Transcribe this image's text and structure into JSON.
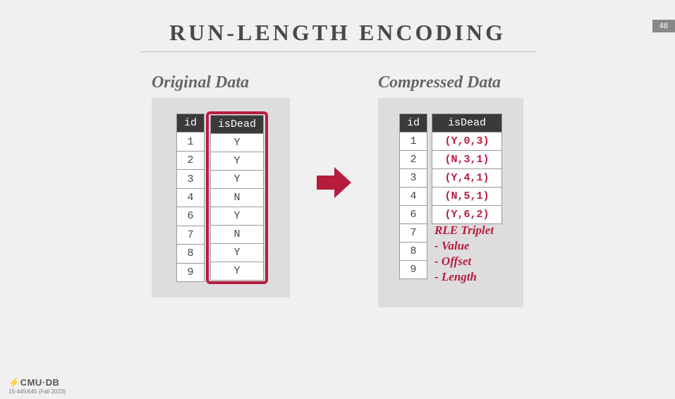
{
  "slideNumber": "48",
  "title": "RUN-LENGTH ENCODING",
  "original": {
    "heading": "Original Data",
    "headers": {
      "id": "id",
      "isDead": "isDead"
    },
    "rows": [
      {
        "id": "1",
        "isDead": "Y"
      },
      {
        "id": "2",
        "isDead": "Y"
      },
      {
        "id": "3",
        "isDead": "Y"
      },
      {
        "id": "4",
        "isDead": "N"
      },
      {
        "id": "6",
        "isDead": "Y"
      },
      {
        "id": "7",
        "isDead": "N"
      },
      {
        "id": "8",
        "isDead": "Y"
      },
      {
        "id": "9",
        "isDead": "Y"
      }
    ]
  },
  "compressed": {
    "heading": "Compressed Data",
    "headers": {
      "id": "id",
      "isDead": "isDead"
    },
    "ids": [
      "1",
      "2",
      "3",
      "4",
      "6",
      "7",
      "8",
      "9"
    ],
    "tuples": [
      "(Y,0,3)",
      "(N,3,1)",
      "(Y,4,1)",
      "(N,5,1)",
      "(Y,6,2)"
    ]
  },
  "note": {
    "title": "RLE Triplet",
    "l1": "- Value",
    "l2": "- Offset",
    "l3": "- Length"
  },
  "footer": {
    "logo": "⚡CMU·DB",
    "sub": "15-445/645 (Fall 2023)"
  }
}
